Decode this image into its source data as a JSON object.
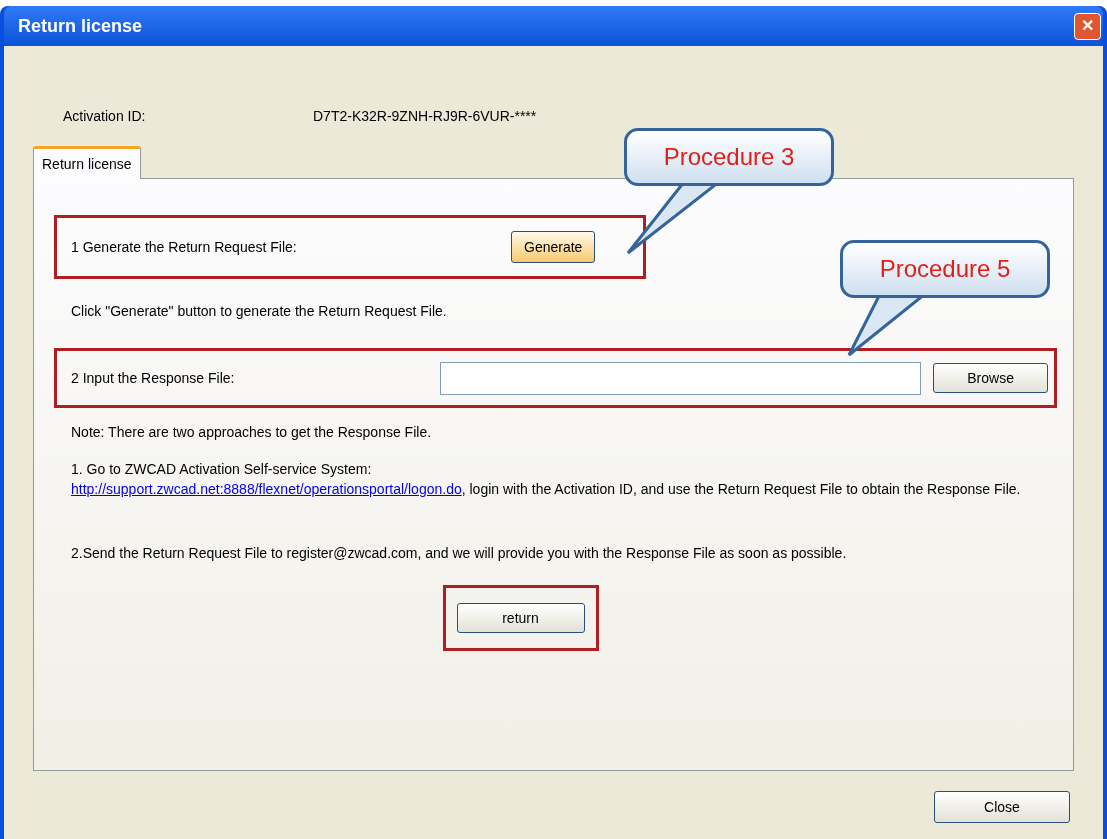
{
  "window": {
    "title": "Return license",
    "close_glyph": "✕"
  },
  "activation": {
    "label": "Activation ID:",
    "value": "D7T2-K32R-9ZNH-RJ9R-6VUR-****"
  },
  "tabs": [
    {
      "label": "Return license",
      "selected": true
    }
  ],
  "step1": {
    "label": "1 Generate the Return Request File:",
    "button": "Generate"
  },
  "step1_hint": "Click \"Generate\" button to generate the Return Request File.",
  "step2": {
    "label": "2 Input the Response File:",
    "button": "Browse"
  },
  "note": "Note: There are two approaches to get the Response File.",
  "approach1": {
    "before": "1. Go to ZWCAD Activation Self-service System:",
    "link": "http://support.zwcad.net:8888/flexnet/operationsportal/logon.do",
    "after": ", login with the Activation ID, and use the Return Request File to obtain the Response File."
  },
  "approach2": "2.Send the Return Request File to register@zwcad.com, and we will provide you with the Response File as soon as possible.",
  "return_button": "return",
  "close_button": "Close",
  "callouts": [
    {
      "text": "Procedure 3"
    },
    {
      "text": "Procedure 5"
    }
  ]
}
